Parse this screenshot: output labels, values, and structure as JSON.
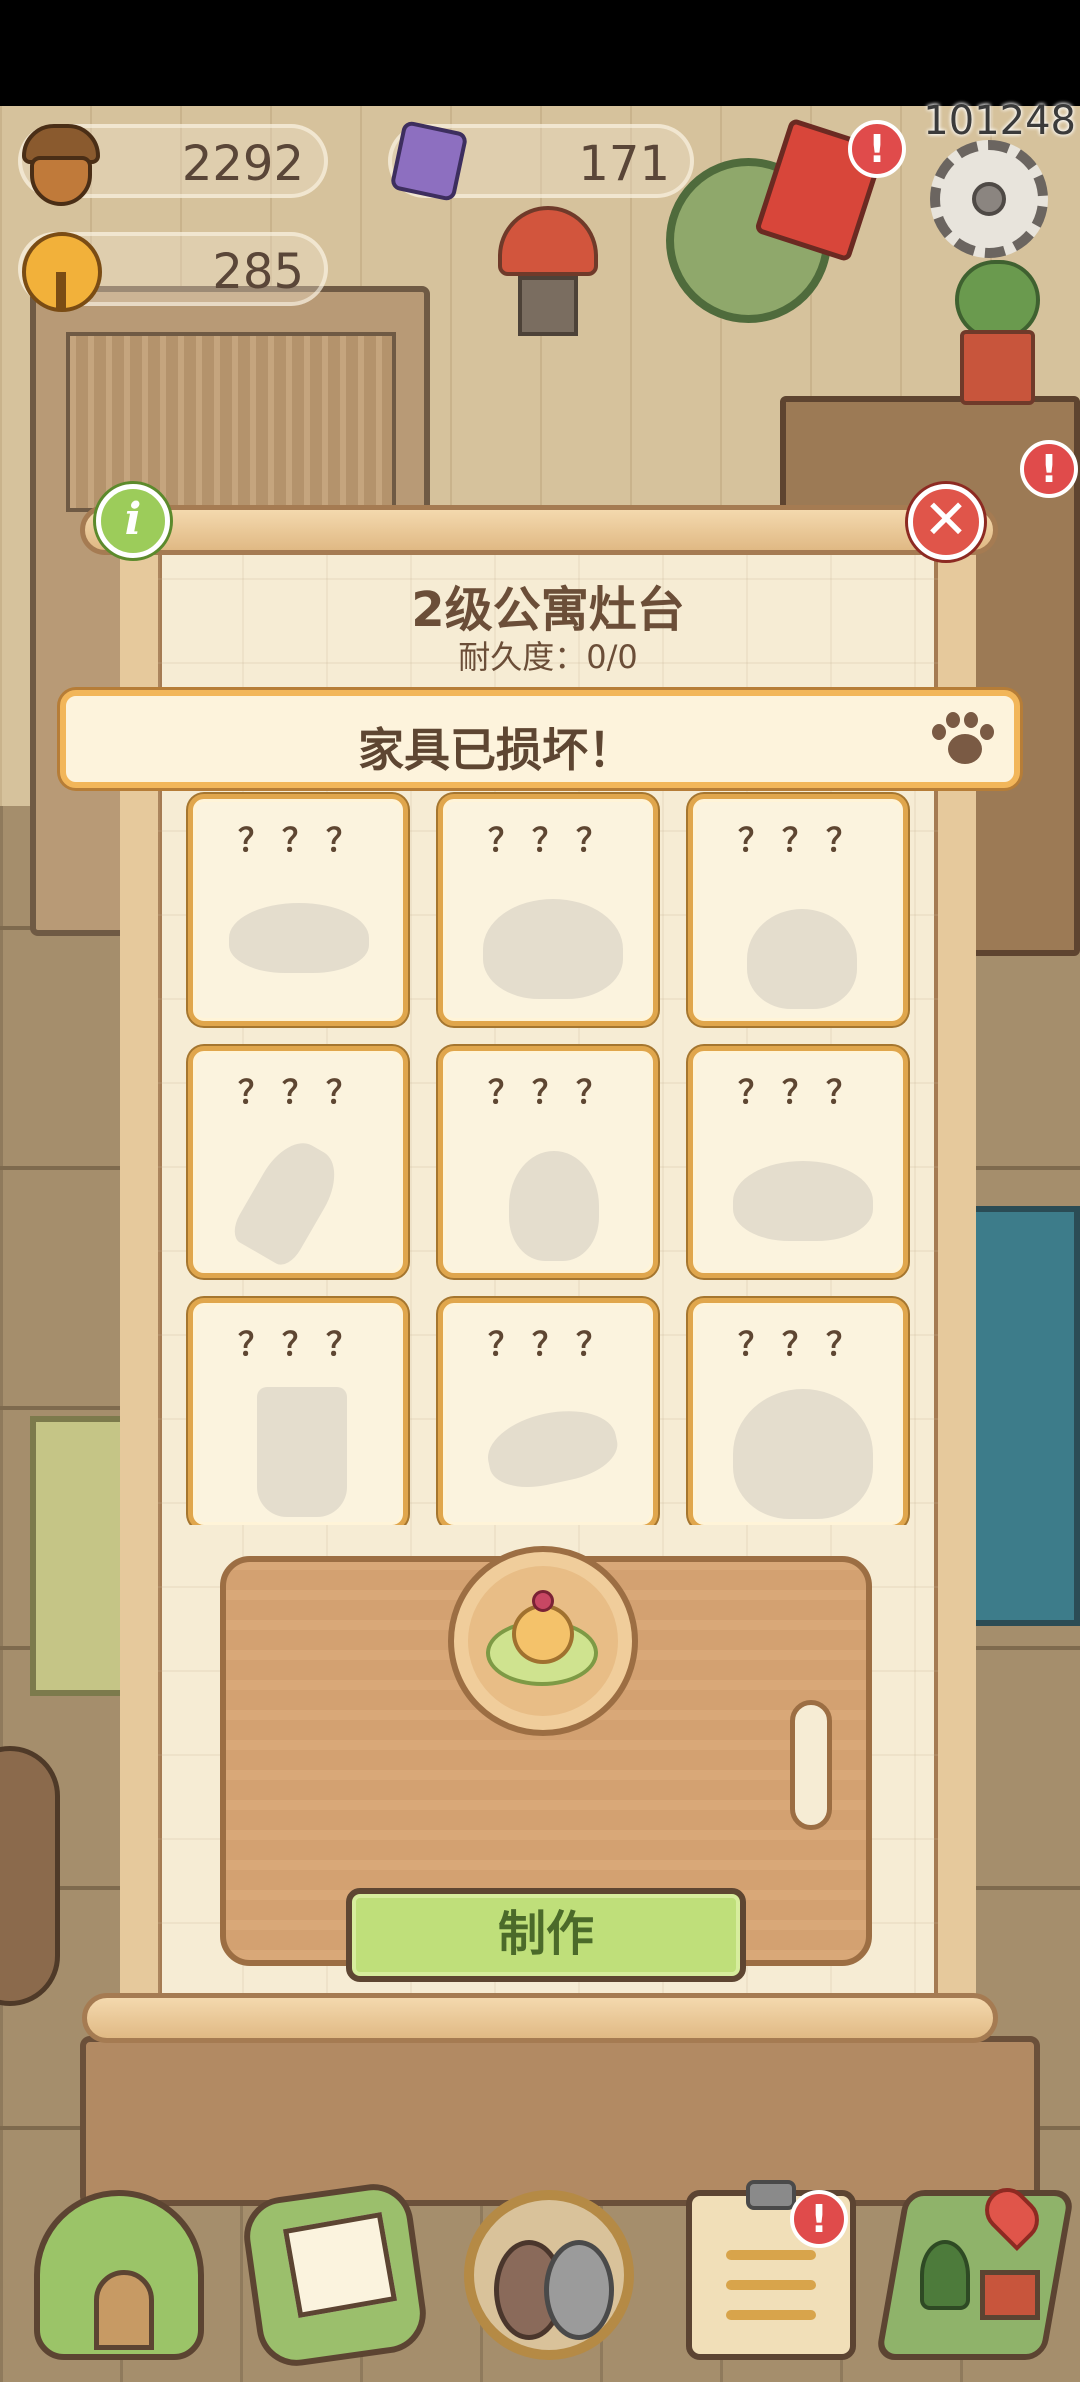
{
  "resources": {
    "acorns": "2292",
    "gems": "171",
    "bells": "285"
  },
  "player_id": "101248",
  "badges": {
    "envelope": "!",
    "shelf_gift": "!",
    "tasks": "!"
  },
  "icons": {
    "acorn": "acorn-icon",
    "gem": "gem-icon",
    "bell": "bell-icon",
    "settings": "gear-icon",
    "info": "info-icon",
    "close": "close-icon",
    "paw": "paw-icon",
    "home": "house-icon",
    "mail": "mail-icon",
    "pets": "pets-icon",
    "tasks": "clipboard-icon",
    "map": "map-icon"
  },
  "modal": {
    "info_label": "i",
    "close_label": "✕",
    "title": "2级公寓灶台",
    "durability": "耐久度：0/0",
    "banner": "家具已损坏！",
    "make_button": "制作"
  },
  "recipes": [
    {
      "name": "？？？",
      "shape": "cloud"
    },
    {
      "name": "？？？",
      "shape": "bun"
    },
    {
      "name": "？？？",
      "shape": "bowl-chopsticks"
    },
    {
      "name": "？？？",
      "shape": "fish"
    },
    {
      "name": "？？？",
      "shape": "sack"
    },
    {
      "name": "？？？",
      "shape": "plate-chopsticks"
    },
    {
      "name": "？？？",
      "shape": "cup"
    },
    {
      "name": "？？？",
      "shape": "shrimp"
    },
    {
      "name": "？？？",
      "shape": "pot"
    }
  ],
  "colors": {
    "parchment": "#f6ecd4",
    "frame": "#e6c99c",
    "cell_border": "#e0a64c",
    "make_button": "#bfdf7a",
    "badge": "#e04b4b",
    "close": "#e0554a",
    "info": "#9ccc5a"
  }
}
